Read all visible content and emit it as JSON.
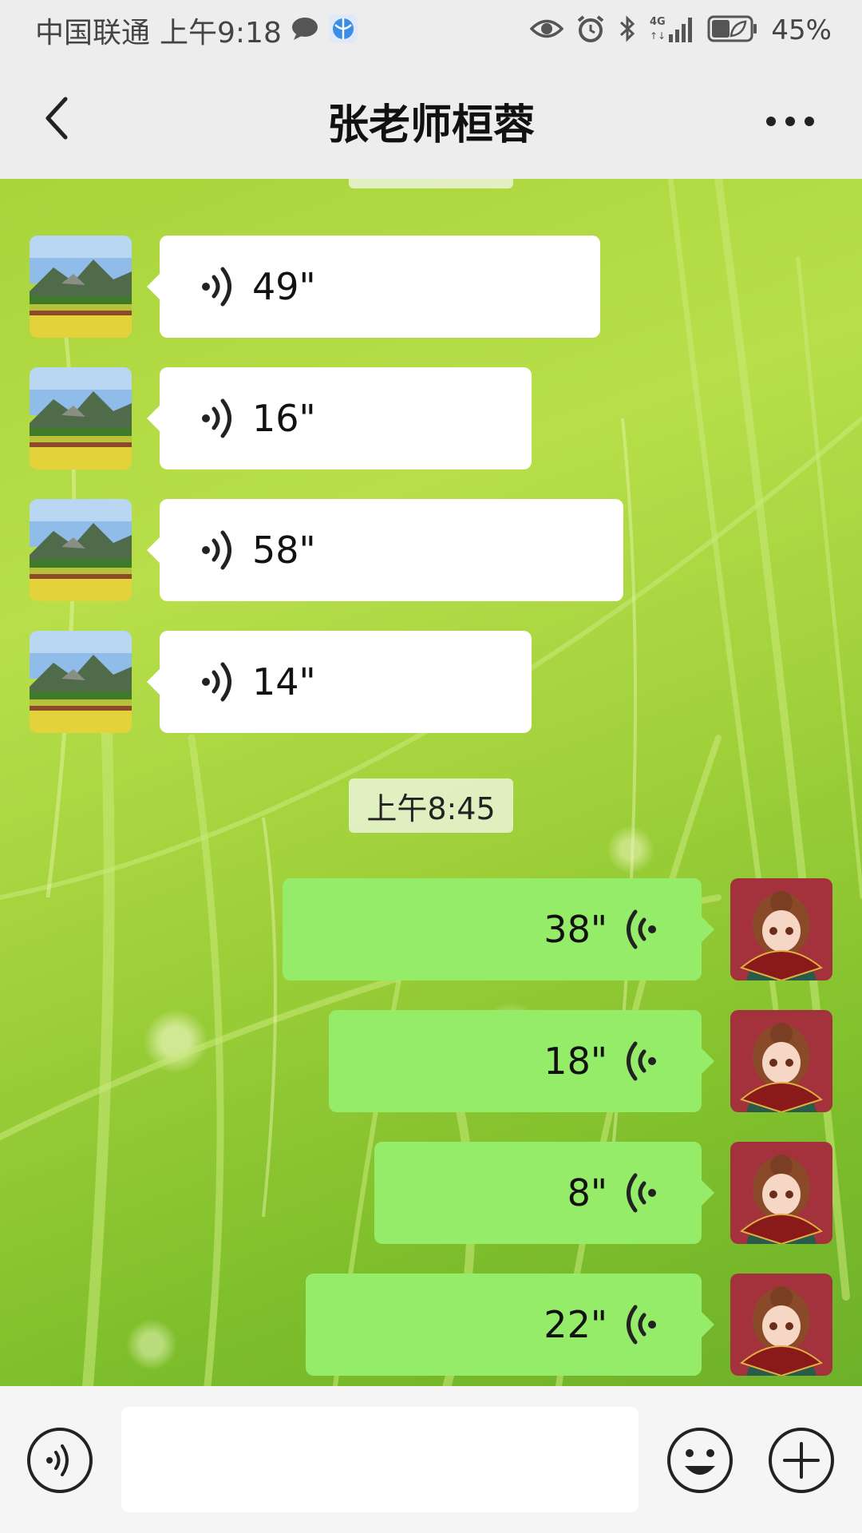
{
  "status_bar": {
    "carrier": "中国联通",
    "time": "上午9:18",
    "battery": "45%",
    "icons": [
      "message-icon",
      "browser-icon",
      "eye-icon",
      "alarm-icon",
      "bluetooth-icon",
      "signal-4g-icon",
      "battery-icon"
    ]
  },
  "header": {
    "title": "张老师桓蓉",
    "back_icon": "chevron-left-icon",
    "more_icon": "more-icon"
  },
  "chat": {
    "incoming": [
      {
        "duration": "49\""
      },
      {
        "duration": "16\""
      },
      {
        "duration": "58\""
      },
      {
        "duration": "14\""
      }
    ],
    "timestamp": "上午8:45",
    "outgoing": [
      {
        "duration": "38\""
      },
      {
        "duration": "18\""
      },
      {
        "duration": "8\""
      },
      {
        "duration": "22\""
      }
    ]
  },
  "input_bar": {
    "input_value": "",
    "icons": [
      "voice-icon",
      "emoji-icon",
      "plus-icon"
    ]
  },
  "colors": {
    "outgoing_bubble": "#95ec69",
    "incoming_bubble": "#ffffff",
    "header_bg": "#ededed"
  }
}
